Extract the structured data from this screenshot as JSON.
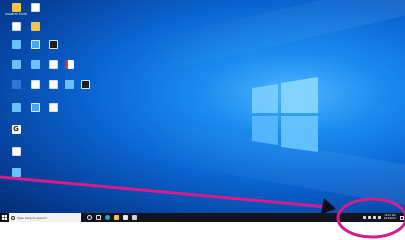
{
  "desktop": {
    "icons": [
      {
        "label": "GIGABYTE SYSTEM INFO",
        "glyph": "app-icon",
        "color": "#f3c647"
      },
      {
        "label": "",
        "glyph": "document-icon"
      },
      {
        "label": "",
        "glyph": "document-icon"
      },
      {
        "label": "",
        "glyph": "document-icon"
      },
      {
        "label": "",
        "glyph": "document-icon"
      },
      {
        "label": "",
        "glyph": "computer-icon"
      },
      {
        "label": "",
        "glyph": "document-icon"
      },
      {
        "label": "",
        "glyph": "terminal-icon"
      },
      {
        "label": "",
        "glyph": "app-icon"
      },
      {
        "label": "",
        "glyph": "app-icon"
      },
      {
        "label": "",
        "glyph": "document-icon"
      },
      {
        "label": "",
        "glyph": "pdf-icon"
      },
      {
        "label": "",
        "glyph": "network-icon"
      },
      {
        "label": "",
        "glyph": "document-icon"
      },
      {
        "label": "",
        "glyph": "document-icon"
      },
      {
        "label": "",
        "glyph": "app-icon"
      },
      {
        "label": "",
        "glyph": "app-icon"
      },
      {
        "label": "",
        "glyph": "computer-icon"
      },
      {
        "label": "",
        "glyph": "document-icon"
      },
      {
        "label": "",
        "glyph": "logo-g-icon"
      },
      {
        "label": "",
        "glyph": "document-icon"
      },
      {
        "label": "",
        "glyph": "app-icon"
      }
    ]
  },
  "taskbar": {
    "search_placeholder": "Type here to search",
    "clock_time": "10:21 AM",
    "clock_date": "1/14/2021"
  },
  "colors": {
    "annotation": "#d81b8c",
    "taskbar": "#10151f",
    "desktop_blue": "#0a63d0"
  }
}
